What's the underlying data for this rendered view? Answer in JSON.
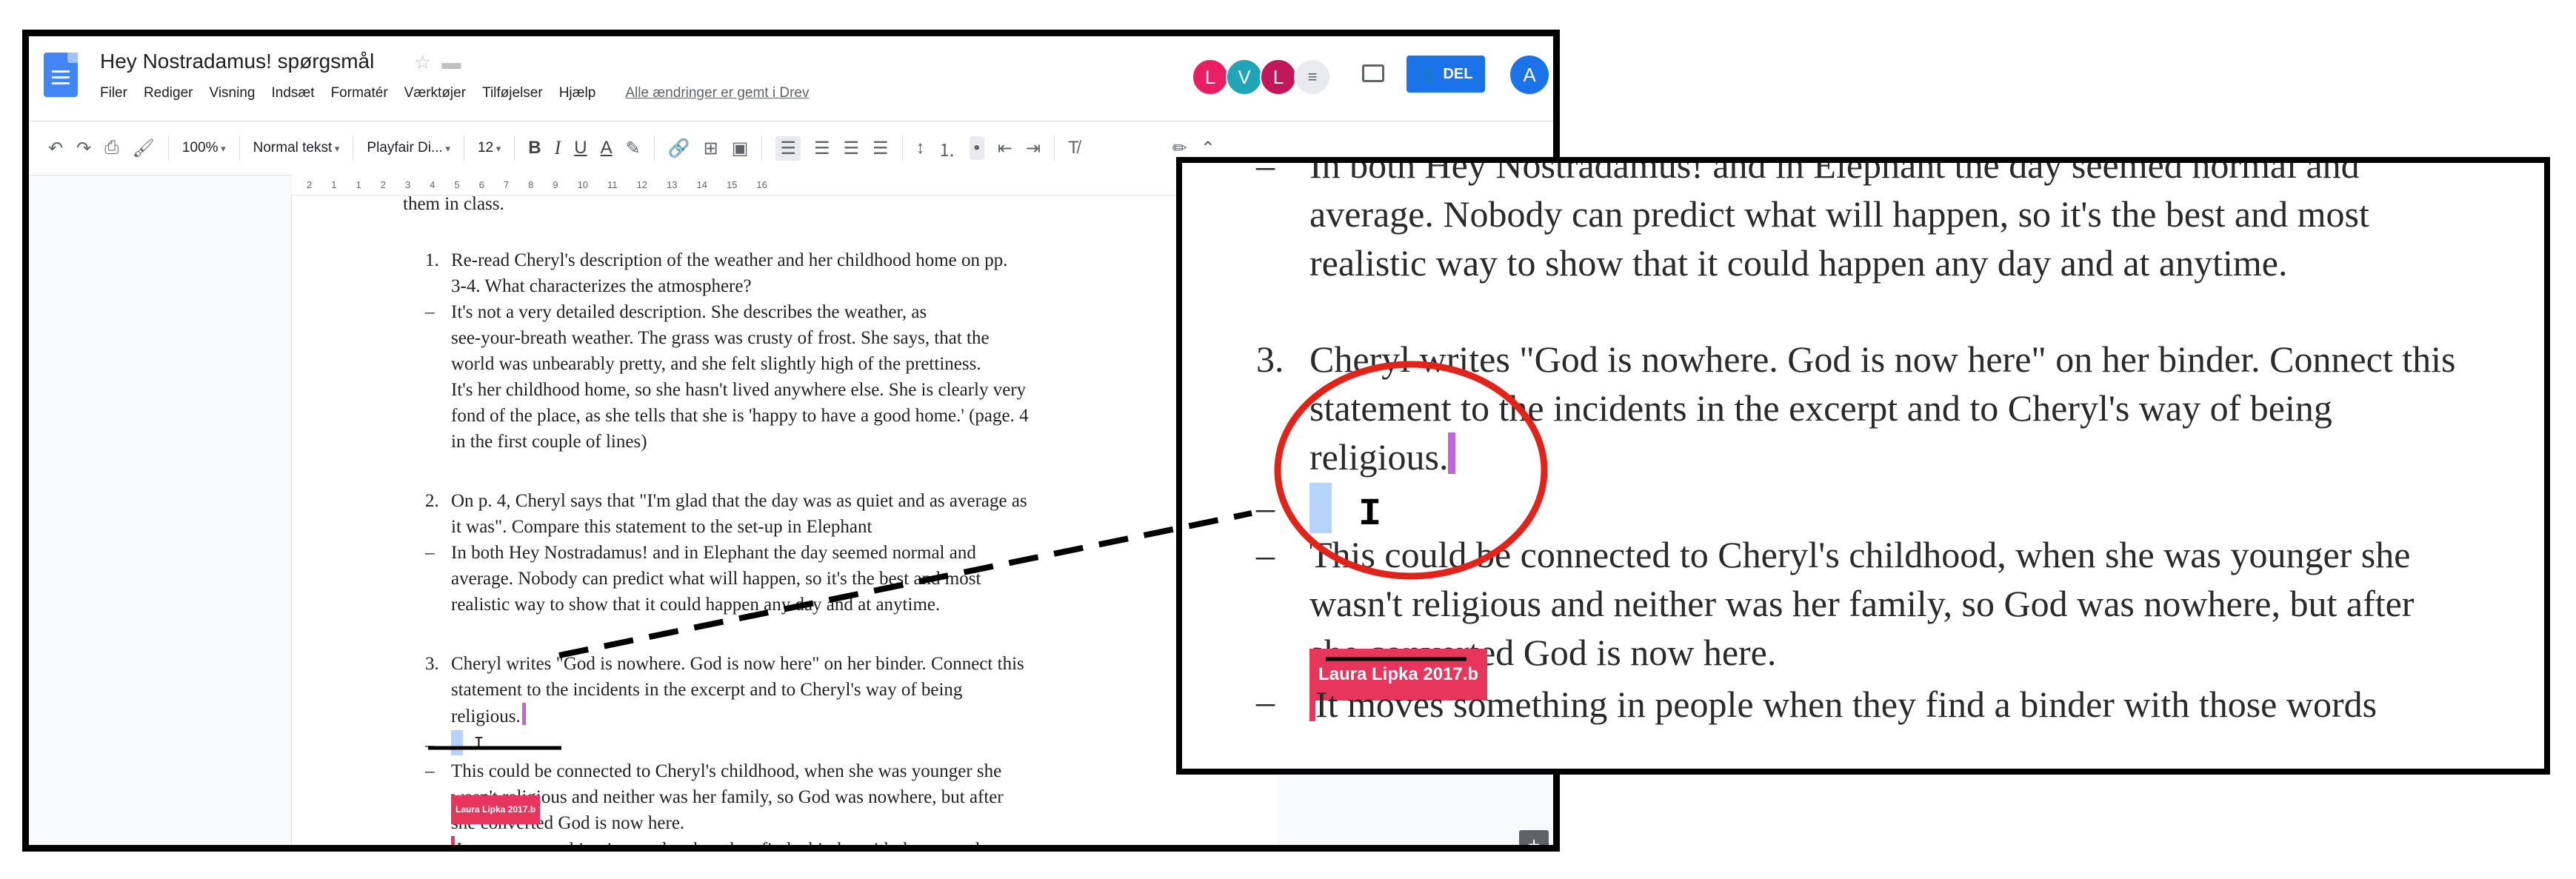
{
  "doc": {
    "title": "Hey Nostradamus! spørgsmål",
    "star_icon": "star-icon",
    "folder_icon": "folder-icon",
    "save_status": "Alle ændringer er gemt i Drev"
  },
  "menu": [
    "Filer",
    "Rediger",
    "Visning",
    "Indsæt",
    "Formatér",
    "Værktøjer",
    "Tilføjelser",
    "Hjælp"
  ],
  "collaborators": [
    {
      "initial": "L",
      "color": "#e91e63"
    },
    {
      "initial": "V",
      "color": "#1fa5b5"
    },
    {
      "initial": "L",
      "color": "#c2185b"
    }
  ],
  "share_label": "DEL",
  "account_initial": "A",
  "toolbar": {
    "zoom": "100%",
    "style": "Normal tekst",
    "font": "Playfair Di...",
    "size": "12",
    "bold": "B",
    "italic": "I",
    "underline": "U",
    "text_color": "A"
  },
  "ruler_marks": [
    "2",
    "1",
    "1",
    "2",
    "3",
    "4",
    "5",
    "6",
    "7",
    "8",
    "9",
    "10",
    "11",
    "12",
    "13",
    "14",
    "15",
    "16"
  ],
  "page": {
    "cut_line": "them in class.",
    "q1": [
      "Re-read Cheryl's description of the weather and her childhood home on pp.",
      "3-4. What characterizes the atmosphere?"
    ],
    "a1": [
      "It's not a very detailed description. She describes the weather, as",
      "see-your-breath weather. The grass was crusty of frost. She says, that the",
      "world was unbearably pretty, and she felt slightly high of the prettiness.",
      "It's her childhood home, so she hasn't lived anywhere else. She is clearly very",
      "fond of the place, as she tells that she is 'happy to have a good home.' (page. 4",
      "in the first couple of lines)"
    ],
    "q2": [
      "On p. 4, Cheryl says that \"I'm glad that the day was as quiet and as average as",
      "it was\". Compare this statement to the set-up in Elephant"
    ],
    "a2": [
      "In both Hey Nostradamus! and in Elephant the day seemed normal and",
      "average. Nobody can predict what will happen, so it's the best and most",
      "realistic way to show that it could happen any day and at anytime."
    ],
    "q3": [
      "Cheryl writes \"God is nowhere. God is now here\" on her binder. Connect this",
      "statement to the incidents in the excerpt and to Cheryl's way of being",
      "religious."
    ],
    "a3": [
      "This could be connected to Cheryl's childhood, when she was younger she",
      "wasn't religious and neither was her family, so God was nowhere, but after",
      "she converted God is now here."
    ],
    "a4": "It moves something in people when they find a binder with those words",
    "markers": {
      "n1": "1.",
      "n2": "2.",
      "n3": "3.",
      "dash": "–"
    },
    "collaborator_tag": "Laura Lipka 2017.b"
  },
  "zoom": {
    "line1": "In both Hey Nostradamus! and in Elephant the day seemed normal and",
    "line2": "average. Nobody can predict what will happen, so it's the best and most",
    "line3": "realistic way to show that it could happen any day and at anytime.",
    "q3_1": "Cheryl writes \"God is nowhere. God is now here\" on her binder. Connect this",
    "q3_2": "statement to the incidents in the excerpt and to Cheryl's way of being",
    "q3_3": "religious.",
    "a3_1": "This could be connected to Cheryl's childhood, when she was younger she",
    "a3_2": "wasn't religious and neither was her family, so God was nowhere, but after",
    "a3_3": "she converted God is now here.",
    "a4": "It moves something in people when they find a binder with those words",
    "num": "3.",
    "dash": "–",
    "tag": "Laura Lipka 2017.b",
    "ibeam": "I"
  }
}
